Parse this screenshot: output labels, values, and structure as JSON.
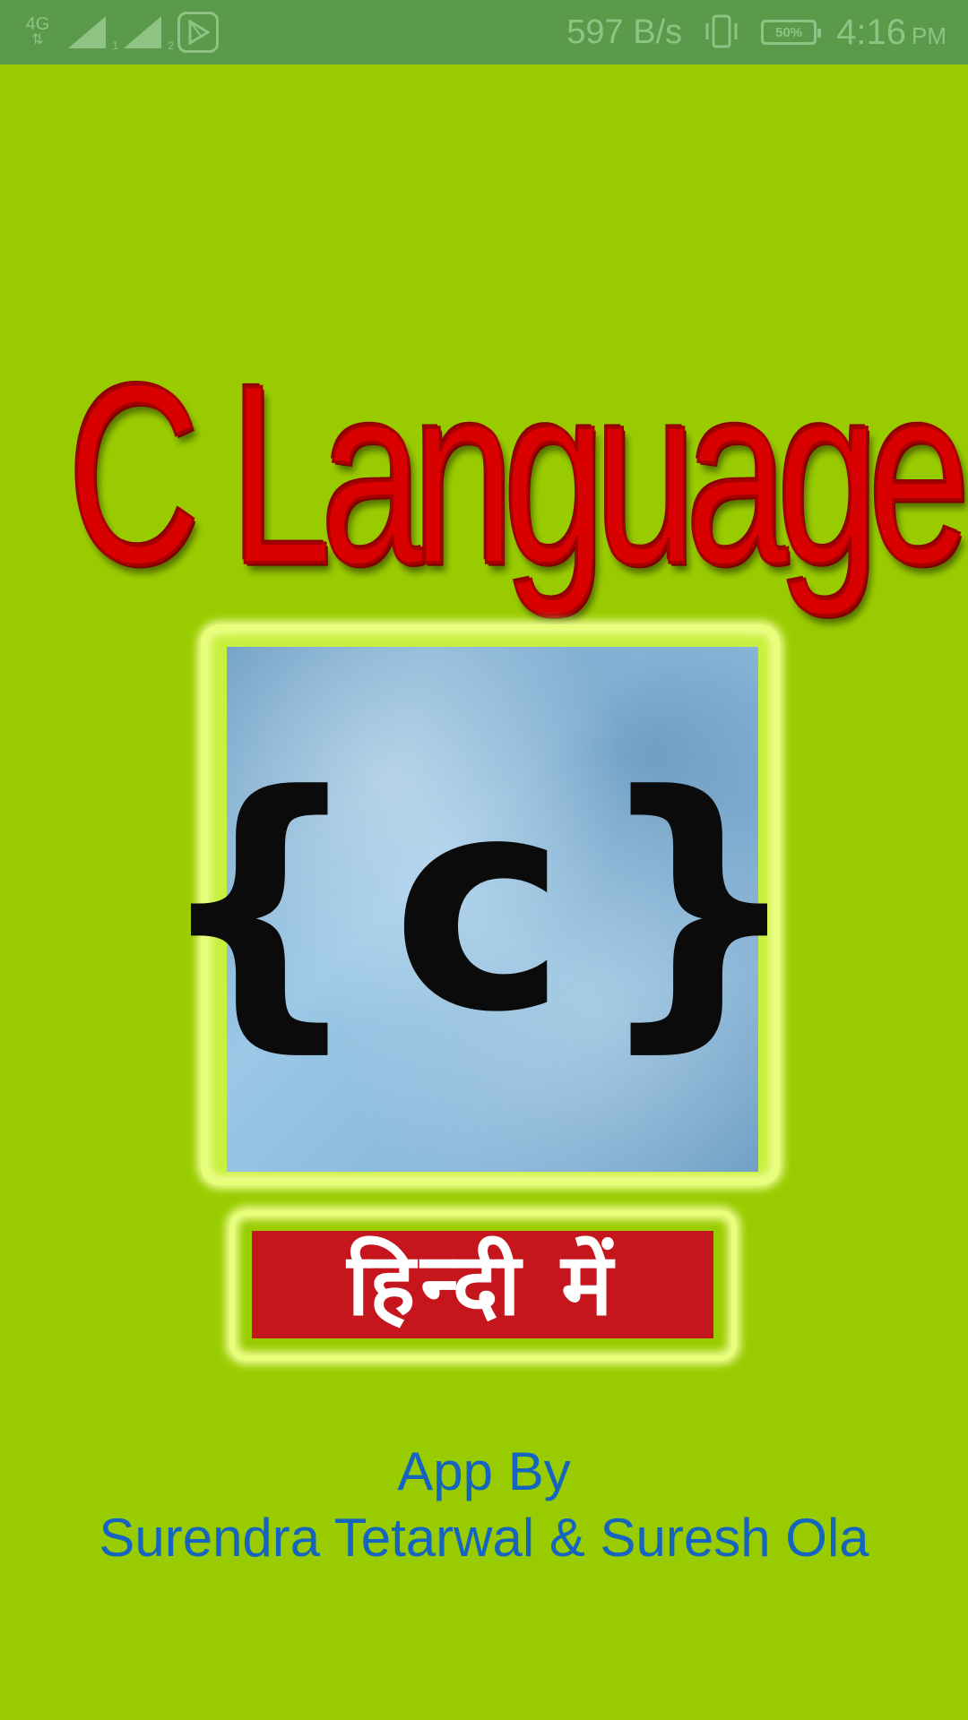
{
  "status_bar": {
    "network_type": "4G",
    "network_arrows": "⇅",
    "sim1_slot": "1",
    "sim2_slot": "2",
    "net_speed": "597 B/s",
    "battery_percent": "50%",
    "time": "4:16",
    "ampm": "PM",
    "icon_color": "#8fc383",
    "background_color": "#5c9a4b"
  },
  "splash": {
    "background_color": "#99cc00",
    "title": "C Language",
    "title_color": "#d90000",
    "logo_text": "{c}",
    "hindi_label": "हिन्दी में",
    "hindi_banner_color": "#c4161c",
    "credit_line1": "App By",
    "credit_line2": "Surendra Tetarwal & Suresh Ola",
    "credit_color": "#1565c0"
  }
}
